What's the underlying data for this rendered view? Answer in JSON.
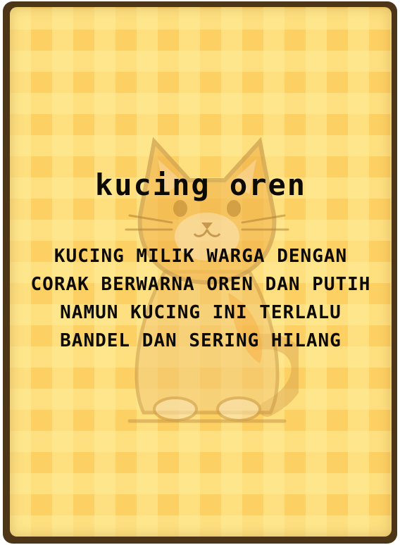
{
  "card": {
    "title": "kucing oren",
    "description": "KUCING MILIK WARGA DENGAN CORAK BERWARNA OREN DAN PUTIH NAMUN KUCING INI TERLALU BANDEL DAN SERING HILANG",
    "illustration_icon": "cat-icon"
  },
  "colors": {
    "frame": "#4d3518",
    "background": "#fcd063",
    "text": "#0c0a05",
    "cat_fur": "#f5b13c"
  }
}
